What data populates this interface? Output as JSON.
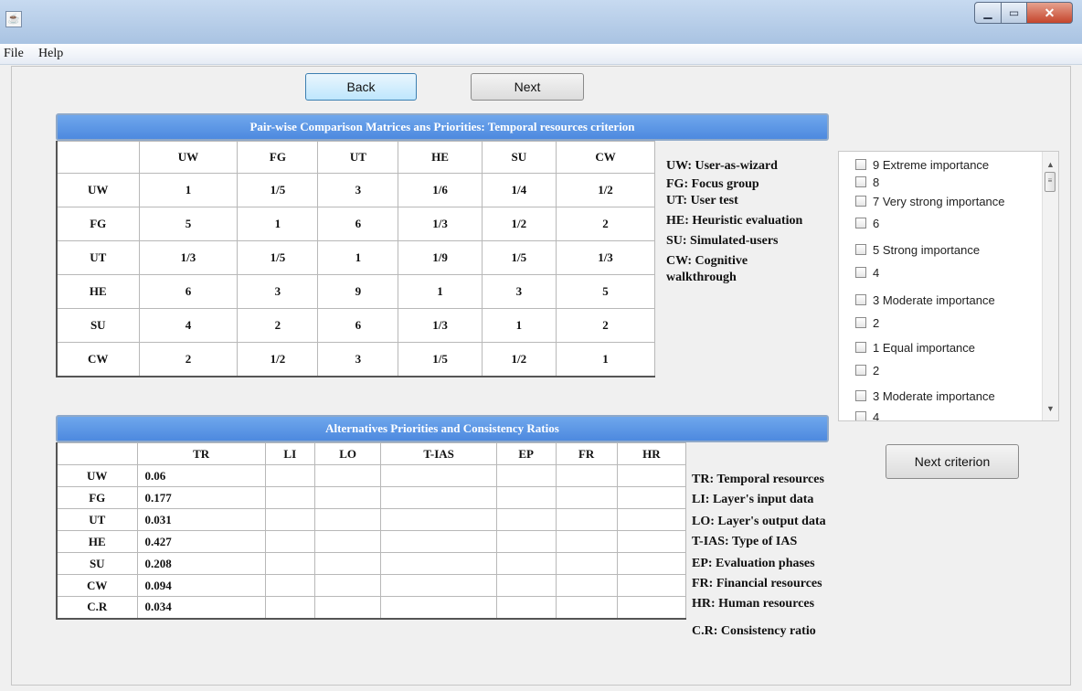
{
  "window": {
    "title": "",
    "app_icon": "java-icon"
  },
  "menu": {
    "file": "File",
    "help": "Help"
  },
  "nav": {
    "back": "Back",
    "next": "Next"
  },
  "matrix": {
    "title": "Pair-wise Comparison Matrices ans Priorities: Temporal resources criterion",
    "columns": [
      "UW",
      "FG",
      "UT",
      "HE",
      "SU",
      "CW"
    ],
    "rows": [
      {
        "label": "UW",
        "cells": [
          "1",
          "1/5",
          "3",
          "1/6",
          "1/4",
          "1/2"
        ]
      },
      {
        "label": "FG",
        "cells": [
          "5",
          "1",
          "6",
          "1/3",
          "1/2",
          "2"
        ]
      },
      {
        "label": "UT",
        "cells": [
          "1/3",
          "1/5",
          "1",
          "1/9",
          "1/5",
          "1/3"
        ]
      },
      {
        "label": "HE",
        "cells": [
          "6",
          "3",
          "9",
          "1",
          "3",
          "5"
        ]
      },
      {
        "label": "SU",
        "cells": [
          "4",
          "2",
          "6",
          "1/3",
          "1",
          "2"
        ]
      },
      {
        "label": "CW",
        "cells": [
          "2",
          "1/2",
          "3",
          "1/5",
          "1/2",
          "1"
        ]
      }
    ]
  },
  "alternatives_legend": [
    "UW: User-as-wizard",
    "FG: Focus group",
    "UT: User test",
    "HE: Heuristic evaluation",
    "SU: Simulated-users",
    "CW: Cognitive",
    "walkthrough"
  ],
  "scale": [
    "9  Extreme importance",
    "8",
    "7 Very strong importance",
    "6",
    "5  Strong importance",
    "4",
    "3  Moderate importance",
    "2",
    "1  Equal importance",
    "2",
    "3  Moderate importance",
    "4"
  ],
  "priorities": {
    "title": "Alternatives Priorities and Consistency Ratios",
    "columns": [
      "TR",
      "LI",
      "LO",
      "T-IAS",
      "EP",
      "FR",
      "HR"
    ],
    "rows": [
      {
        "label": "UW",
        "cells": [
          "0.06",
          "",
          "",
          "",
          "",
          "",
          ""
        ]
      },
      {
        "label": "FG",
        "cells": [
          "0.177",
          "",
          "",
          "",
          "",
          "",
          ""
        ]
      },
      {
        "label": "UT",
        "cells": [
          "0.031",
          "",
          "",
          "",
          "",
          "",
          ""
        ]
      },
      {
        "label": "HE",
        "cells": [
          "0.427",
          "",
          "",
          "",
          "",
          "",
          ""
        ]
      },
      {
        "label": "SU",
        "cells": [
          "0.208",
          "",
          "",
          "",
          "",
          "",
          ""
        ]
      },
      {
        "label": "CW",
        "cells": [
          "0.094",
          "",
          "",
          "",
          "",
          "",
          ""
        ]
      },
      {
        "label": "C.R",
        "cells": [
          "0.034",
          "",
          "",
          "",
          "",
          "",
          ""
        ]
      }
    ]
  },
  "criteria_legend": [
    "TR: Temporal resources",
    "LI: Layer's input data",
    "LO: Layer's output data",
    "T-IAS: Type of IAS",
    "EP: Evaluation phases",
    "FR: Financial resources",
    "HR: Human resources",
    "C.R: Consistency ratio"
  ],
  "next_criterion": "Next criterion",
  "colors": {
    "header_blue": "#4d89df",
    "titlebar": "#a9c3e2",
    "close_red": "#c5452c"
  }
}
